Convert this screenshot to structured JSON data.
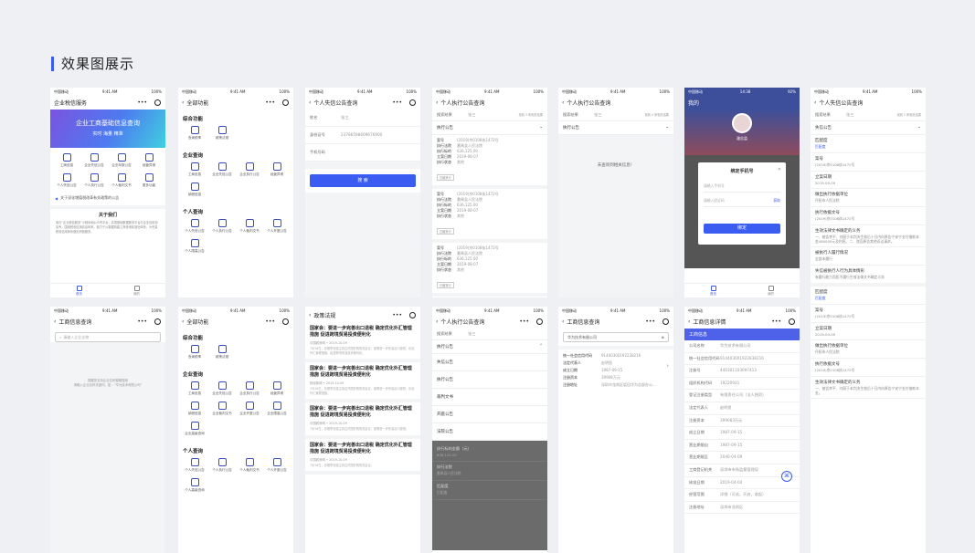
{
  "title": "效果图展示",
  "status": {
    "carrier": "中国移动",
    "time": "9:41 AM",
    "battery": "100%"
  },
  "p1": {
    "nav": "企业税信服务",
    "banner_title": "企业工商基础信息查询",
    "banner_sub": "实时 海量 精准",
    "grid": [
      "工商信息",
      "企业失信公告",
      "企业年报公告",
      "经营异常",
      "个人失信公告",
      "个人执行公告",
      "个人裁判文书",
      "更多功能"
    ],
    "notice": "关于深化增值税改革有关政策的公告",
    "about_title": "关于我们",
    "about_body": "用与“企业税信服务”小程序和公众号平台，实现基础数据服务平台与企业信用协会专，围绕税收信用信息体系，致力于从数据构建工商查询精准化体系，为完善税收信用体系做出积极服务。",
    "tabs": [
      "首页",
      "我的"
    ]
  },
  "p2": {
    "nav": "全部功能",
    "sec1": "综合功能",
    "g1": [
      "查询税率",
      "政策法规"
    ],
    "sec2": "企业查询",
    "g2": [
      "工商信息",
      "企业失信公告",
      "企业执行公告",
      "经营异常",
      "纳税信息"
    ],
    "sec3": "个人查询",
    "g3": [
      "个人失信公告",
      "个人执行公告",
      "个人裁判文书",
      "个人开庭公告",
      "个人限高公告"
    ]
  },
  "p3": {
    "nav": "个人失信公告查询",
    "name_k": "姓名",
    "name_v": "张三",
    "id_k": "身份证号",
    "id_v": "23786598609676900",
    "phone_k": "手机号码",
    "phone_v": "",
    "btn": "搜 索"
  },
  "p4": {
    "nav": "个人执行公告查询",
    "search_k": "搜索结果",
    "search_v": "张三",
    "result_hint": "找到 3 条相关结果",
    "cat": "执行公告",
    "cards": [
      {
        "k": [
          "案号",
          "执行法院",
          "执行标的",
          "立案日期",
          "执行状态"
        ],
        "v": [
          "(2019)京0108执1472号",
          "番禺县人民法院",
          "636,125.00",
          "2019-08-07",
          "其他"
        ],
        "tag": "已被执行"
      },
      {
        "k": [
          "案号",
          "执行法院",
          "执行标的",
          "立案日期",
          "执行状态"
        ],
        "v": [
          "(2019)京0108执1472号",
          "番禺县人民法院",
          "636,125.00",
          "2019-08-07",
          "其他"
        ],
        "tag": "已被执行"
      },
      {
        "k": [
          "案号",
          "执行法院",
          "执行标的",
          "立案日期",
          "执行状态"
        ],
        "v": [
          "(2019)京0108执1472号",
          "番禺县人民法院",
          "636,125.00",
          "2019-08-07",
          "其他"
        ],
        "tag": "已被执行"
      }
    ]
  },
  "p5": {
    "nav": "个人执行公告查询",
    "search_k": "搜索结果",
    "search_v": "张三",
    "result_hint": "找到 0 条相关结果",
    "cat": "执行公告",
    "empty": "未查询到相关信息！"
  },
  "p6": {
    "nav": "我的",
    "time": "14:38",
    "battery": "92%",
    "user": "潘总监",
    "modal_title": "绑定手机号",
    "ph_phone": "请输入手机号",
    "ph_code": "请输入验证码",
    "get_code": "获取",
    "btn": "绑定",
    "tabs": [
      "首页",
      "我的"
    ]
  },
  "p7": {
    "nav": "个人失信公告查询",
    "search_k": "搜索结果",
    "search_v": "张三",
    "result_hint": "找到 2 条相关结果",
    "cat": "失信公告",
    "items": [
      [
        "匹配度",
        "匹配度"
      ],
      [
        "案号",
        "(2019)京0108执1472号"
      ],
      [
        "立案日期",
        "2019-09-09"
      ],
      [
        "做出执行依据单位",
        "丹阳市人民法院"
      ],
      [
        "执行依据文号",
        "(2019)京0108执1472号"
      ]
    ],
    "duty_t": "生效法律文书确定的义务",
    "duty_v": "一、被告李平、刘丽于本判决生效后十日内向原告宁安宁支付借款本金480000元及利息。二、驳回原告其他诉讼请求。",
    "perf_t": "被执行人履行情况",
    "perf_v": "全部未履行",
    "beh_t": "失信被执行人行为具体情形",
    "beh_v": "有履行能力而拒不履行生效法律文书确定义务",
    "items2": [
      [
        "匹配度",
        "匹配度"
      ],
      [
        "案号",
        "(2019)京0108执1472号"
      ],
      [
        "立案日期",
        "2019-09-09"
      ],
      [
        "做出执行依据单位",
        "丹阳市人民法院"
      ],
      [
        "执行依据文号",
        "(2019)京0108执1472号"
      ]
    ],
    "duty2_t": "生效法律文书确定的义务",
    "duty2_v": "一、被告李平、刘丽于本判决生效后十日内向原告宁安宁支付借款本金。"
  },
  "p8": {
    "nav": "工商信息查询",
    "ph": "请输入企业全称",
    "hint": "提醒您支持企业名称模糊搜索\n请输入企业名称关键词，如：“华为技术有限公司”"
  },
  "p9": {
    "nav": "全部功能",
    "sec1": "综合功能",
    "g1": [
      "查询税率",
      "政策法规"
    ],
    "sec2": "企业查询",
    "g2": [
      "工商信息",
      "企业失信公告",
      "企业执行公告",
      "经营异常",
      "纳税信息",
      "企业裁判文书",
      "企业开庭公告",
      "企业限高公告",
      "企业高级查询"
    ],
    "sec3": "个人查询",
    "g3": [
      "个人失信公告",
      "个人执行公告",
      "个人裁判文书",
      "个人开庭公告",
      "个人高级查询"
    ]
  },
  "p10": {
    "nav": "政策法规",
    "news": [
      {
        "t": "国家会：要进一步完善出口退税 确定优化外汇管理措施 促进跨境贸易投资便利化",
        "m": "中国政府网 • 2019-10-09",
        "b": "7月16日，总理李克强主持召开国务院常务会议，部署进一步完善出口退税，优化外汇管理措施，促进跨境贸易投资便利化。"
      },
      {
        "t": "国家会：要进一步完善出口退税 确定优化外汇管理措施 促进跨境贸易投资便利化",
        "m": "财经新闻 • 2019-10-09",
        "b": "7月16日，总理李克强主持召开国务院常务会议，部署进一步完善出口退税，优化外汇管理措施。"
      },
      {
        "t": "国家会：要进一步完善出口退税 确定优化外汇管理措施 促进跨境贸易投资便利化",
        "m": "中国政府网 • 2019-10-09",
        "b": "7月16日，总理李克强主持召开国务院常务会议，部署进一步完善出口退税。"
      },
      {
        "t": "国家会：要进一步完善出口退税 确定优化外汇管理措施 促进跨境贸易投资便利化",
        "m": "中国政府网 • 2019-10-09",
        "b": "7月16日，总理李克强主持召开国务院常务会议。"
      }
    ]
  },
  "p11": {
    "nav": "个人执行公告查询",
    "search_k": "搜索结果",
    "search_v": "张三",
    "cat": "执行公告",
    "opts": [
      "失信公告",
      "执行公告",
      "裁判文书",
      "开庭公告",
      "法院公告"
    ],
    "dark": [
      [
        "执行标的金额（元）",
        "636,125.00"
      ],
      [
        "执行法院",
        "番禺县人民法院"
      ],
      [
        "匹配度",
        "匹配度"
      ]
    ]
  },
  "p12": {
    "nav": "工商信息查询",
    "search": "华为技术有限公司",
    "rows": [
      [
        "统一社会信用代码",
        "91440300192238216"
      ],
      [
        "法定代表人",
        "赵明思"
      ],
      [
        "成立日期",
        "1987-09-15"
      ],
      [
        "注册资本",
        "39908万元"
      ],
      [
        "注册地址",
        "深圳市龙岗区坂田华为总部办公..."
      ]
    ]
  },
  "p13": {
    "nav": "工商信息详情",
    "hl": "工商信息",
    "rows": [
      [
        "公司名称",
        "华为技术有限公司"
      ],
      [
        "统一社会信用代码",
        "914403001922838216"
      ],
      [
        "注册号",
        "440301103097413"
      ],
      [
        "组织机构代码",
        "19220921"
      ],
      [
        "登记注册类型",
        "有限责任公司（法人独资）"
      ],
      [
        "法定代表人",
        "赵明思"
      ],
      [
        "注册资本",
        "399083万元"
      ],
      [
        "成立日期",
        "1987-09-15"
      ],
      [
        "营业期限自",
        "1987-09-15"
      ],
      [
        "营业期限至",
        "2040-04-09"
      ],
      [
        "工商登记机关",
        "深圳市市场监督管理局"
      ],
      [
        "核准日期",
        "2019-04-04"
      ],
      [
        "经营范围",
        "详细（可选，开启，收起）"
      ],
      [
        "注册地址",
        "深圳市龙岗区"
      ]
    ]
  }
}
